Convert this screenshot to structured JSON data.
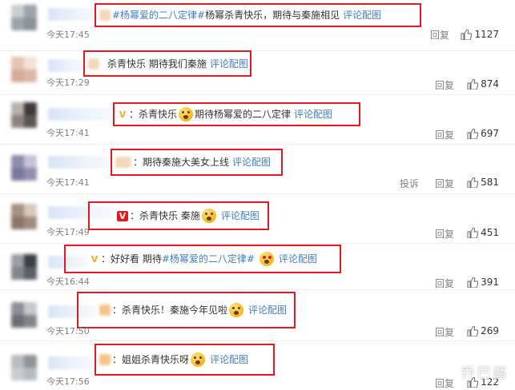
{
  "comments": [
    {
      "time": "今天17:45",
      "tag": "#杨幂爱的二八定律#",
      "text": " 杨幂杀青快乐，期待与秦施相见",
      "picture_link": "评论配图",
      "reply": "回复",
      "likes": "1127"
    },
    {
      "time": "今天17:29",
      "text": "杀青快乐 期待我们秦施",
      "picture_link": "评论配图",
      "reply": "回复",
      "likes": "874"
    },
    {
      "time": "今天17:41",
      "badge": "V",
      "text": "：杀青快乐",
      "emoji": "scream-emoji",
      "text2": "期待杨幂爱的二八定律",
      "picture_link": "评论配图",
      "reply": "回复",
      "likes": "697"
    },
    {
      "time": "今天17:41",
      "text": "：期待秦施大美女上线",
      "picture_link": "评论配图",
      "report": "投诉",
      "reply": "回复",
      "likes": "581"
    },
    {
      "time": "今天17:49",
      "badge": "V",
      "text": "：杀青快乐 秦施",
      "emoji": "smile-emoji",
      "picture_link": "评论配图",
      "reply": "回复",
      "likes": "451"
    },
    {
      "time": "今天16:44",
      "badge": "V",
      "text": "：好好看 期待",
      "tag": "#杨幂爱的二八定律#",
      "emoji": "heart-eyes-emoji",
      "picture_link": "评论配图",
      "reply": "回复",
      "likes": "391"
    },
    {
      "time": "今天17:50",
      "text": "：杀青快乐！秦施今年见啦",
      "emoji": "scream-emoji",
      "picture_link": "评论配图",
      "reply": "回复",
      "likes": "269"
    },
    {
      "time": "今天17:56",
      "text": "：姐姐杀青快乐呀",
      "emoji": "scream-emoji",
      "picture_link": "评论配图",
      "reply": "回复",
      "likes": "122"
    }
  ],
  "watermark": "乔巴酱",
  "colors": {
    "highlight_border": "#e8161f",
    "link": "#3f7ec6",
    "meta_text": "#808080"
  }
}
